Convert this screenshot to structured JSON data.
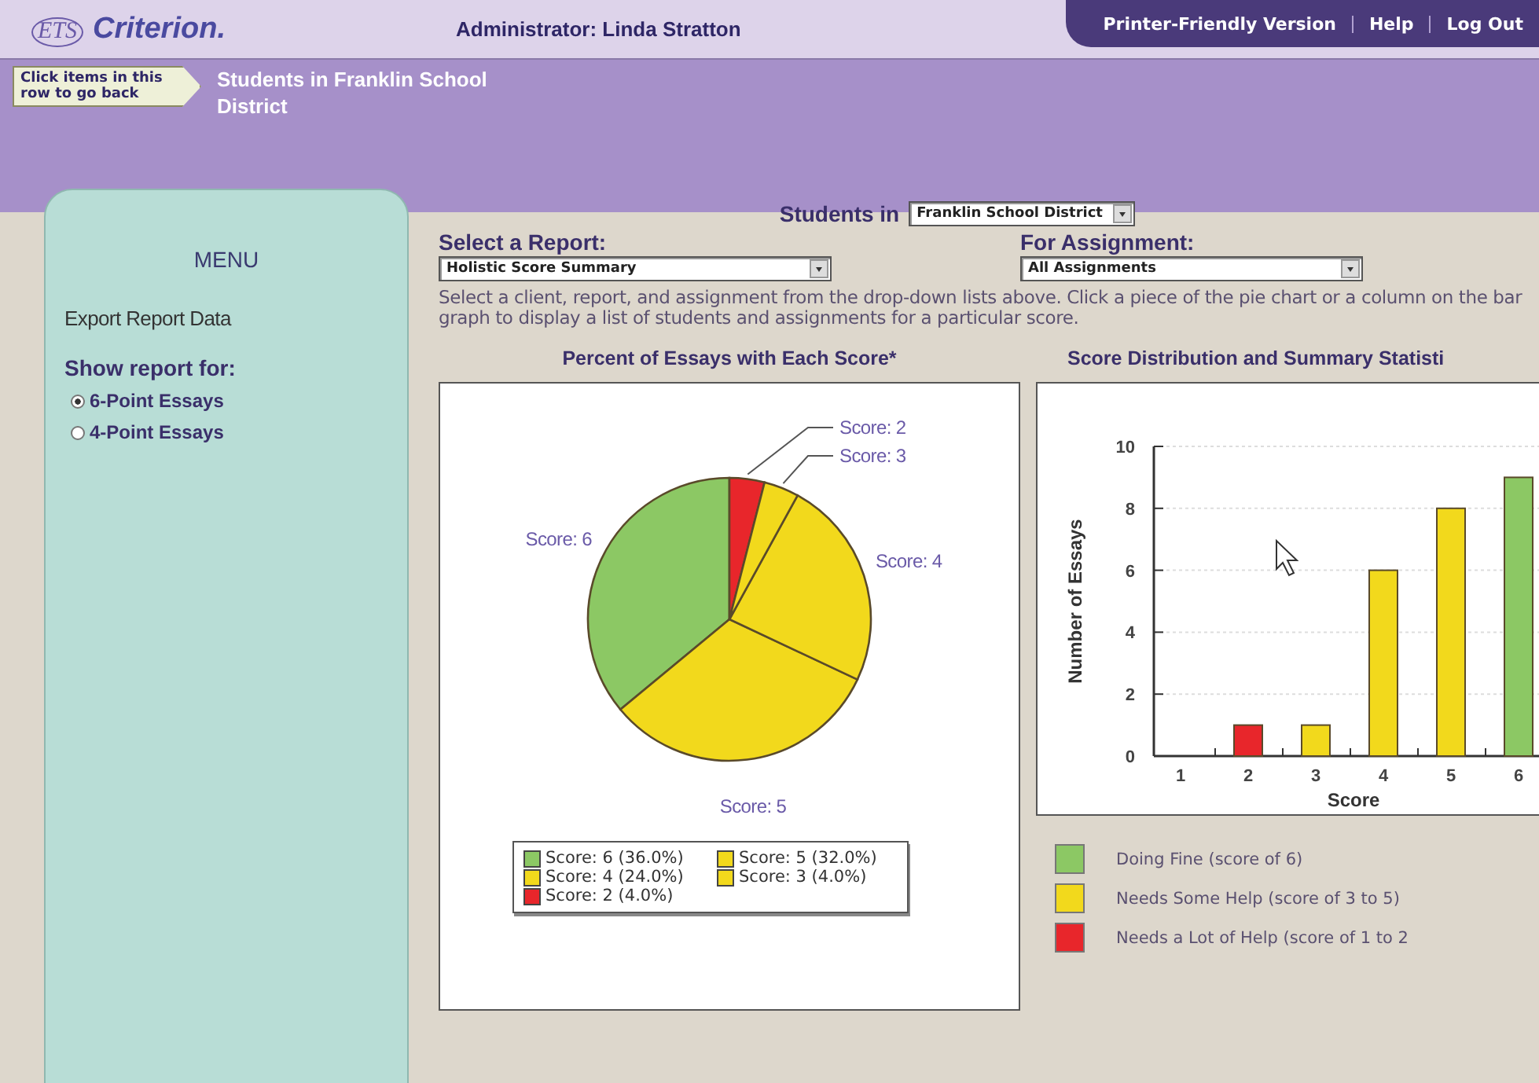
{
  "header": {
    "logo_mark": "ETS",
    "logo_text": "Criterion.",
    "user": "Administrator: Linda Stratton",
    "links": [
      "Printer-Friendly Version",
      "Help",
      "Log Out"
    ]
  },
  "breadcrumb": {
    "back_hint": "Click items in this row to go back",
    "current": "Students in Franklin School District"
  },
  "sidebar": {
    "title": "MENU",
    "link": "Export Report Data",
    "show_label": "Show report for:",
    "options": [
      {
        "label": "6-Point Essays",
        "selected": true
      },
      {
        "label": "4-Point Essays",
        "selected": false
      }
    ]
  },
  "filters": {
    "students_label": "Students in",
    "students_value": "Franklin School District",
    "report_label": "Select a Report:",
    "report_value": "Holistic Score Summary",
    "assignment_label": "For Assignment:",
    "assignment_value": "All Assignments"
  },
  "description": "Select a client, report, and assignment from the drop-down lists above. Click a piece of the pie chart or a column on the bar graph to display a list of students and assignments for a particular score.",
  "pie_panel": {
    "chart_data": {
      "type": "pie",
      "title": "Percent of Essays with Each Score*",
      "categories": [
        "Score: 2",
        "Score: 3",
        "Score: 4",
        "Score: 5",
        "Score: 6"
      ],
      "values": [
        4,
        4,
        24,
        32,
        36
      ],
      "colors": [
        "#e8262b",
        "#f2d91c",
        "#f2d91c",
        "#f2d91c",
        "#8cc864"
      ]
    },
    "legend": [
      {
        "label": "Score: 6 (36.0%)",
        "color": "#8cc864"
      },
      {
        "label": "Score: 5 (32.0%)",
        "color": "#f2d91c"
      },
      {
        "label": "Score: 4 (24.0%)",
        "color": "#f2d91c"
      },
      {
        "label": "Score: 3 (4.0%)",
        "color": "#f2d91c"
      },
      {
        "label": "Score: 2 (4.0%)",
        "color": "#e8262b"
      }
    ]
  },
  "bar_panel": {
    "chart_data": {
      "type": "bar",
      "title": "Score Distribution and Summary Statisti",
      "xlabel": "Score",
      "ylabel": "Number of Essays",
      "categories": [
        "1",
        "2",
        "3",
        "4",
        "5",
        "6"
      ],
      "values": [
        0,
        1,
        1,
        6,
        8,
        9
      ],
      "colors": [
        "#f2d91c",
        "#e8262b",
        "#f2d91c",
        "#f2d91c",
        "#f2d91c",
        "#8cc864"
      ],
      "ylim": [
        0,
        10
      ],
      "grid": true,
      "yticks": [
        0,
        2,
        4,
        6,
        8,
        10
      ]
    },
    "legend": [
      {
        "label": "Doing Fine (score of 6)",
        "color": "#8cc864"
      },
      {
        "label": "Needs Some Help (score of 3 to 5)",
        "color": "#f2d91c"
      },
      {
        "label": "Needs a Lot of Help (score of 1 to 2",
        "color": "#e8262b"
      }
    ]
  }
}
